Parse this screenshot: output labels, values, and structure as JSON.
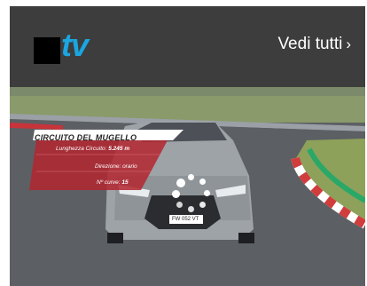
{
  "header": {
    "logo_text": "tv",
    "see_all_label": "Vedi tutti",
    "see_all_icon": "chevron-right-icon"
  },
  "video": {
    "overlay": {
      "title": "CIRCUITO DEL MUGELLO",
      "length_label": "Lunghezza Circuito:",
      "length_value": "5.245 m",
      "direction_label": "Direzione: orario",
      "turns_label": "Nº curve:",
      "turns_value": "15"
    },
    "plate": "FW 052 VT",
    "state": "loading"
  },
  "colors": {
    "accent": "#1aa6e0",
    "header_bg": "#3d3d3d",
    "overlay_red": "#b3262f"
  }
}
